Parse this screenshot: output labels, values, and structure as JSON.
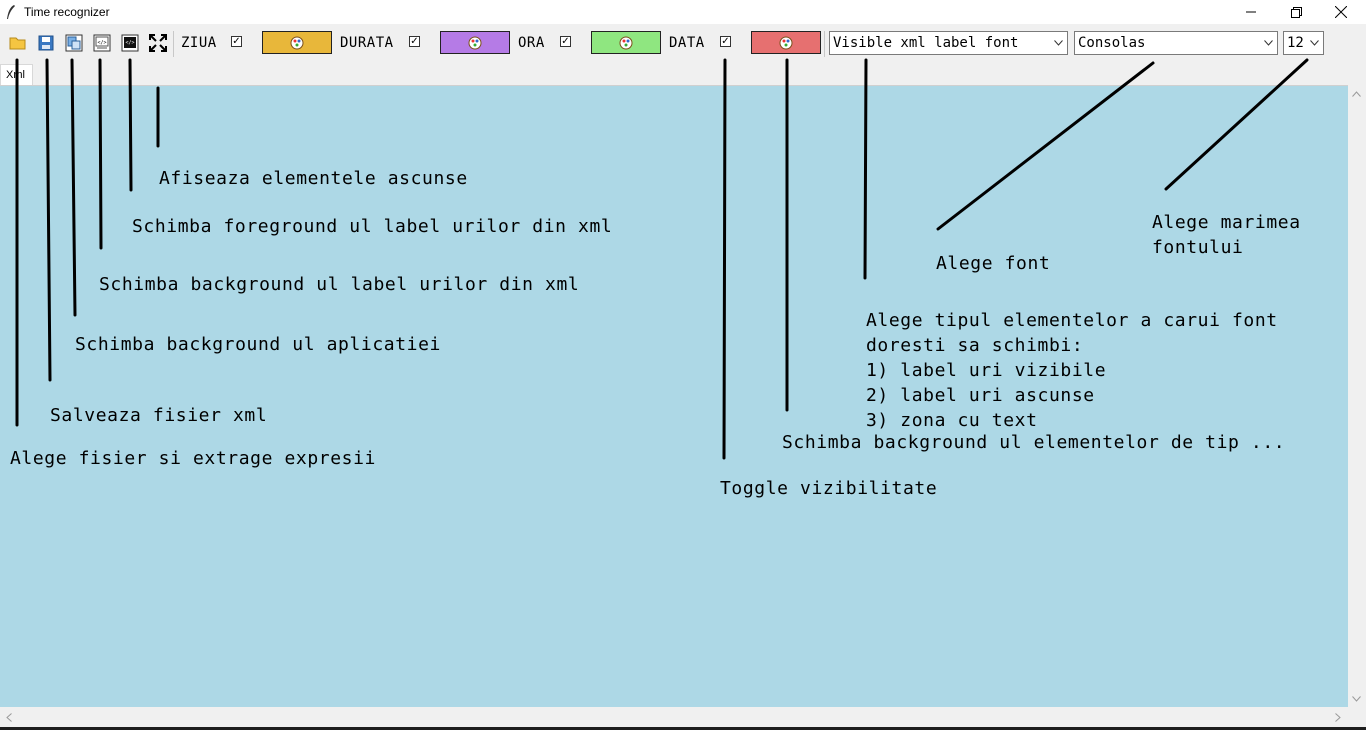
{
  "window": {
    "title": "Time recognizer",
    "minimize_icon": "minimize-icon",
    "maximize_icon": "restore-icon",
    "close_icon": "close-icon"
  },
  "toolbar": {
    "buttons": [
      {
        "name": "open-file",
        "icon": "folder-icon"
      },
      {
        "name": "save-xml",
        "icon": "floppy-disk-icon"
      },
      {
        "name": "app-background",
        "icon": "copy-paint-icon"
      },
      {
        "name": "label-background",
        "icon": "xml-file-icon"
      },
      {
        "name": "label-foreground",
        "icon": "dark-xml-file-icon"
      },
      {
        "name": "show-hidden",
        "icon": "fullscreen-expand-icon"
      }
    ],
    "categories": [
      {
        "label": "ZIUA",
        "checked": true,
        "color": "#e8b73a"
      },
      {
        "label": "DURATA",
        "checked": true,
        "color": "#b57be6"
      },
      {
        "label": "ORA",
        "checked": true,
        "color": "#8fe680"
      },
      {
        "label": "DATA",
        "checked": true,
        "color": "#e67070"
      }
    ],
    "check_mark": "✓",
    "element_type_select": "Visible xml label font",
    "font_select": "Consolas",
    "size_select": "12"
  },
  "tabs": [
    {
      "label": "Xml"
    }
  ],
  "canvas": {
    "background": "#add8e6"
  },
  "annotations": {
    "show_hidden": "Afiseaza elementele ascunse",
    "label_foreground": "Schimba foreground ul label urilor din xml",
    "label_background": "Schimba background ul label urilor din xml",
    "app_background": "Schimba background ul aplicatiei",
    "save_xml": "Salveaza fisier xml",
    "open_file": "Alege fisier si extrage expresii",
    "font_size": "Alege marimea\nfontului",
    "choose_font": "Alege font",
    "element_type": "Alege tipul elementelor a carui font\ndoresti sa schimbi:\n1) label uri vizibile\n2) label uri ascunse\n3) zona cu text",
    "element_background": "Schimba background ul elementelor de tip ...",
    "toggle_visibility": "Toggle vizibilitate"
  }
}
